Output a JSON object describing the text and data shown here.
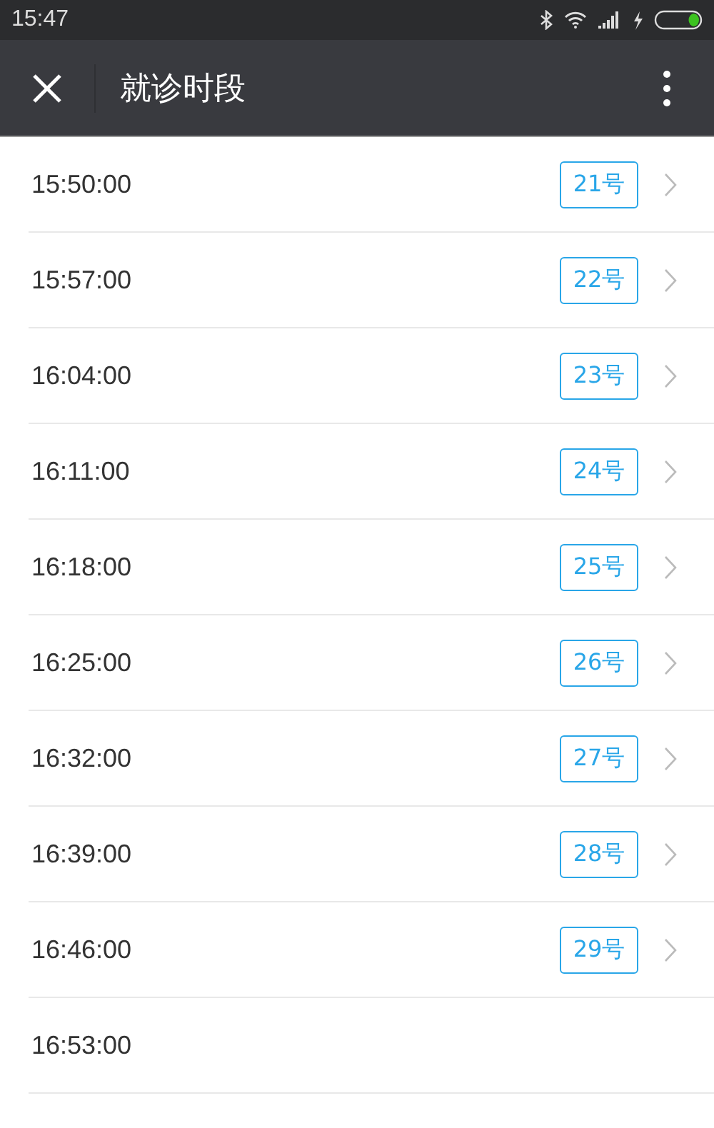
{
  "status_bar": {
    "time": "15:47",
    "charging": true
  },
  "toolbar": {
    "title": "就诊时段"
  },
  "slots": [
    {
      "time": "15:50:00",
      "number": "21号"
    },
    {
      "time": "15:57:00",
      "number": "22号"
    },
    {
      "time": "16:04:00",
      "number": "23号"
    },
    {
      "time": "16:11:00",
      "number": "24号"
    },
    {
      "time": "16:18:00",
      "number": "25号"
    },
    {
      "time": "16:25:00",
      "number": "26号"
    },
    {
      "time": "16:32:00",
      "number": "27号"
    },
    {
      "time": "16:39:00",
      "number": "28号"
    },
    {
      "time": "16:46:00",
      "number": "29号"
    },
    {
      "time": "16:53:00"
    }
  ]
}
